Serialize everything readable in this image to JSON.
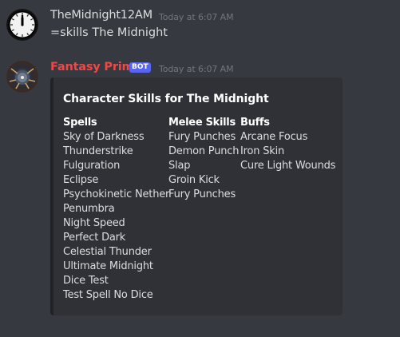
{
  "messages": [
    {
      "username": "TheMidnight12AM",
      "timestamp": "Today at 6:07 AM",
      "text": "=skills The Midnight",
      "avatar": "clock-avatar"
    },
    {
      "username": "Fantasy Prime",
      "bot_tag": "BOT",
      "timestamp": "Today at 6:07 AM",
      "avatar": "fantasy-prime-avatar",
      "username_color": "#f04747"
    }
  ],
  "embed": {
    "title": "Character Skills for The Midnight",
    "fields": [
      {
        "name": "Spells",
        "values": [
          "Sky of Darkness",
          "Thunderstrike",
          "Fulguration",
          "Eclipse",
          "Psychokinetic Nether",
          "Penumbra",
          "Night Speed",
          "Perfect Dark",
          "Celestial Thunder",
          "Ultimate Midnight",
          "Dice Test",
          "Test Spell No Dice"
        ]
      },
      {
        "name": "Melee Skills",
        "values": [
          "Fury Punches",
          "Demon Punch",
          "Slap",
          "Groin Kick",
          "Fury Punches"
        ]
      },
      {
        "name": "Buffs",
        "values": [
          "Arcane Focus",
          "Iron Skin",
          "Cure Light Wounds"
        ]
      }
    ]
  },
  "colors": {
    "background": "#36393f",
    "embed_background": "#2f3136",
    "bot_tag": "#5865f2",
    "timestamp": "#72767d"
  }
}
